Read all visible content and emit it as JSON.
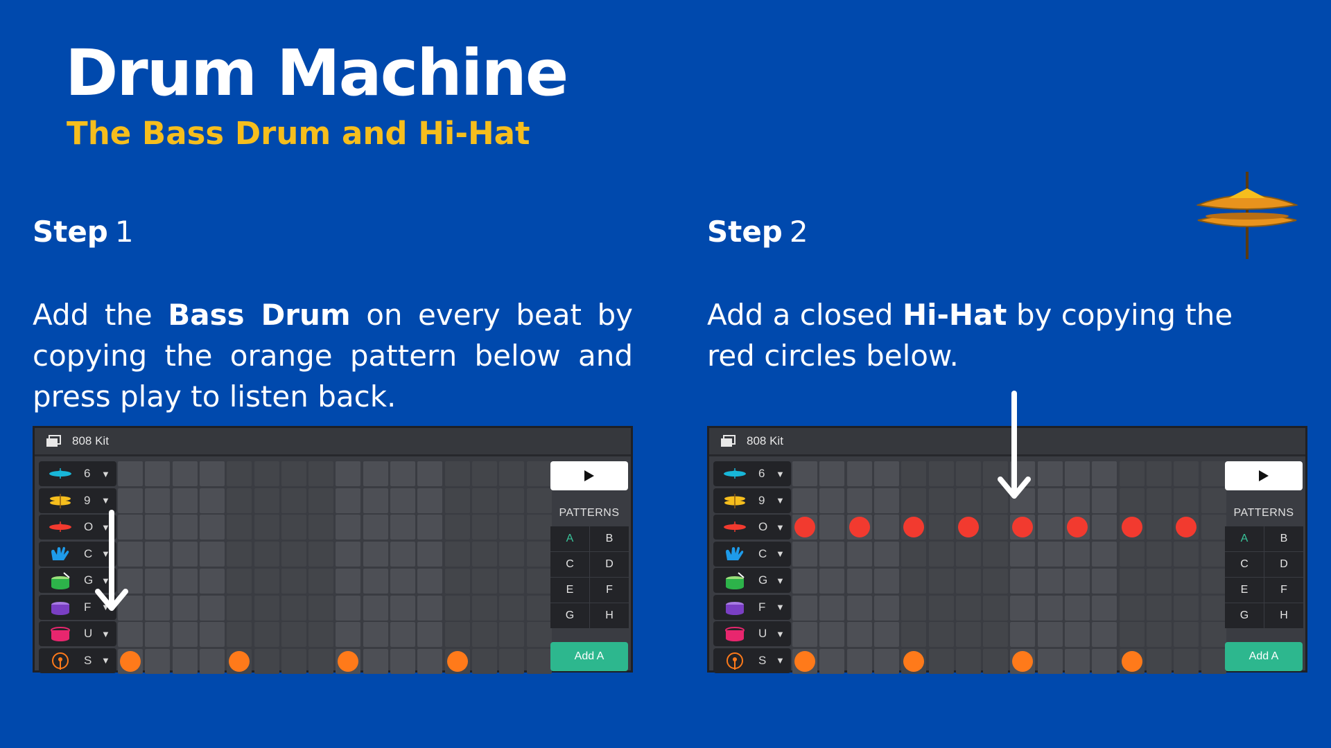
{
  "header": {
    "title": "Drum Machine",
    "subtitle": "The Bass Drum and Hi-Hat"
  },
  "steps": [
    {
      "label_bold": "Step",
      "label_num": "1",
      "text_1": "Add the ",
      "text_bold": "Bass Drum",
      "text_2": " on every beat by copying the orange pattern below and press play to listen back."
    },
    {
      "label_bold": "Step",
      "label_num": "2",
      "text_1": "Add a closed ",
      "text_bold": "Hi-Hat",
      "text_2": " by copying the red circles below."
    }
  ],
  "machine": {
    "kit_name": "808 Kit",
    "caret": "▼",
    "tracks": [
      {
        "key": "6",
        "icon": "cyan-cymbal-icon",
        "color": "#18B7D9"
      },
      {
        "key": "9",
        "icon": "yellow-cymbal-icon",
        "color": "#F6BE1D"
      },
      {
        "key": "O",
        "icon": "red-hihat-icon",
        "color": "#F23A2F"
      },
      {
        "key": "C",
        "icon": "clap-icon",
        "color": "#1E9BEA"
      },
      {
        "key": "G",
        "icon": "green-snare-icon",
        "color": "#2DB34A"
      },
      {
        "key": "F",
        "icon": "purple-tom-icon",
        "color": "#7A3FC4"
      },
      {
        "key": "U",
        "icon": "pink-drum-icon",
        "color": "#E8266E"
      },
      {
        "key": "S",
        "icon": "bass-drum-icon",
        "color": "#FF7A1A"
      }
    ],
    "steps_per_row": 16,
    "patterns_label": "PATTERNS",
    "patterns": [
      "A",
      "B",
      "C",
      "D",
      "E",
      "F",
      "G",
      "H"
    ],
    "active_pattern": "A",
    "add_label": "Add A",
    "machine1_notes": {
      "bass_drum": [
        1,
        5,
        9,
        13
      ]
    },
    "machine2_notes": {
      "hi_hat": [
        1,
        3,
        5,
        7,
        9,
        11,
        13,
        15
      ],
      "bass_drum": [
        1,
        5,
        9,
        13
      ]
    },
    "colors": {
      "bass_drum": "#FF7A1A",
      "hi_hat": "#F23A2F",
      "add_button": "#2DB78E"
    }
  }
}
